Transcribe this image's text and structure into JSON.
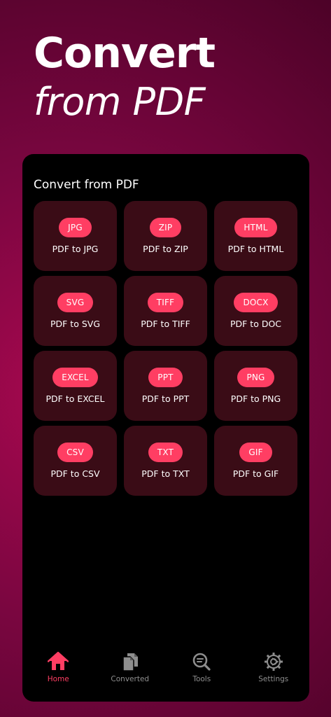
{
  "hero": {
    "line1": "Convert",
    "line2": "from PDF"
  },
  "section": {
    "title": "Convert from PDF"
  },
  "conversions": [
    {
      "badge": "JPG",
      "label": "PDF to JPG"
    },
    {
      "badge": "ZIP",
      "label": "PDF to ZIP"
    },
    {
      "badge": "HTML",
      "label": "PDF to HTML"
    },
    {
      "badge": "SVG",
      "label": "PDF to SVG"
    },
    {
      "badge": "TIFF",
      "label": "PDF to TIFF"
    },
    {
      "badge": "DOCX",
      "label": "PDF to DOC"
    },
    {
      "badge": "EXCEL",
      "label": "PDF to EXCEL"
    },
    {
      "badge": "PPT",
      "label": "PDF to PPT"
    },
    {
      "badge": "PNG",
      "label": "PDF to PNG"
    },
    {
      "badge": "CSV",
      "label": "PDF to CSV"
    },
    {
      "badge": "TXT",
      "label": "PDF to TXT"
    },
    {
      "badge": "GIF",
      "label": "PDF to GIF"
    }
  ],
  "tabs": [
    {
      "label": "Home",
      "icon": "home-icon",
      "active": true
    },
    {
      "label": "Converted",
      "icon": "documents-icon",
      "active": false
    },
    {
      "label": "Tools",
      "icon": "search-document-icon",
      "active": false
    },
    {
      "label": "Settings",
      "icon": "gear-icon",
      "active": false
    }
  ],
  "colors": {
    "accent": "#ff3e63",
    "tile_bg": "#3a0c16",
    "inactive": "#8e8e8e",
    "panel_bg": "#000000"
  }
}
